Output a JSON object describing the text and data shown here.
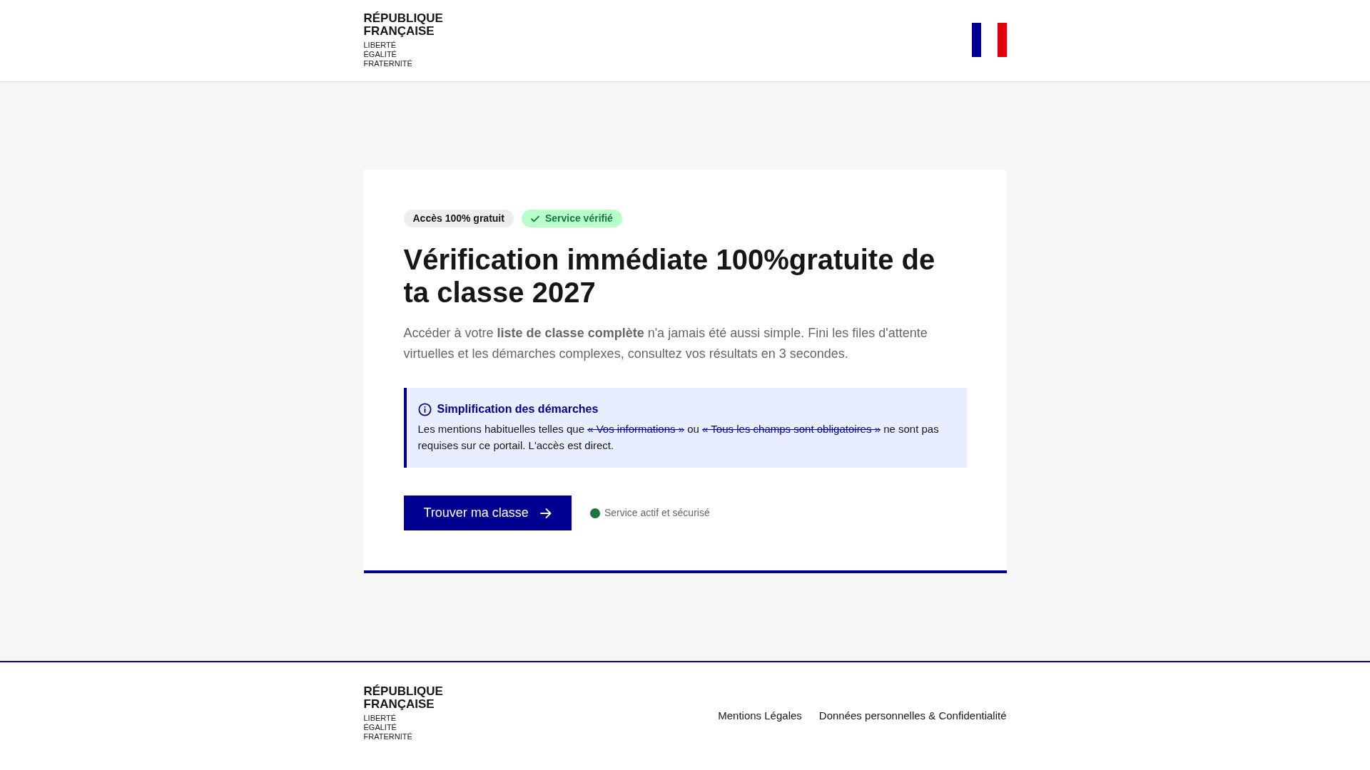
{
  "header": {
    "logo": {
      "title_lines": [
        "RÉPUBLIQUE",
        "FRANÇAISE"
      ],
      "motto_lines": [
        "LIBERTÉ",
        "ÉGALITÉ",
        "FRATERNITÉ"
      ]
    }
  },
  "card": {
    "badges": [
      {
        "kind": "neutral",
        "label": "Accès 100% gratuit"
      },
      {
        "kind": "success",
        "label": "Service vérifié"
      }
    ],
    "title": "Vérification immédiate 100%gratuite de ta classe 2027",
    "intro": "Accéder à votre **liste de classe complète** n'a jamais été aussi simple. Fini les files d'attente virtuelles et les démarches complexes, consultez vos résultats en 3 secondes.",
    "notice": {
      "title": "Simplification des démarches",
      "parts": [
        {
          "kind": "text",
          "text": "Les mentions habituelles telles que"
        },
        {
          "kind": "struck_link",
          "text": "« Vos informations »"
        },
        {
          "kind": "text",
          "text": "ou"
        },
        {
          "kind": "struck_link",
          "text": "« Tous les champs sont obligatoires »"
        },
        {
          "kind": "text",
          "text": "ne sont pas requises sur ce portail. L'accès est direct."
        }
      ]
    },
    "button": {
      "label": "Trouver ma classe"
    },
    "status": {
      "label": "Service actif et sécurisé"
    }
  },
  "footer": {
    "logo": {
      "title_lines": [
        "RÉPUBLIQUE",
        "FRANÇAISE"
      ],
      "motto_lines": [
        "LIBERTÉ",
        "ÉGALITÉ",
        "FRATERNITÉ"
      ]
    },
    "links": [
      "Mentions Légales",
      "Données personnelles & Confidentialité"
    ]
  }
}
